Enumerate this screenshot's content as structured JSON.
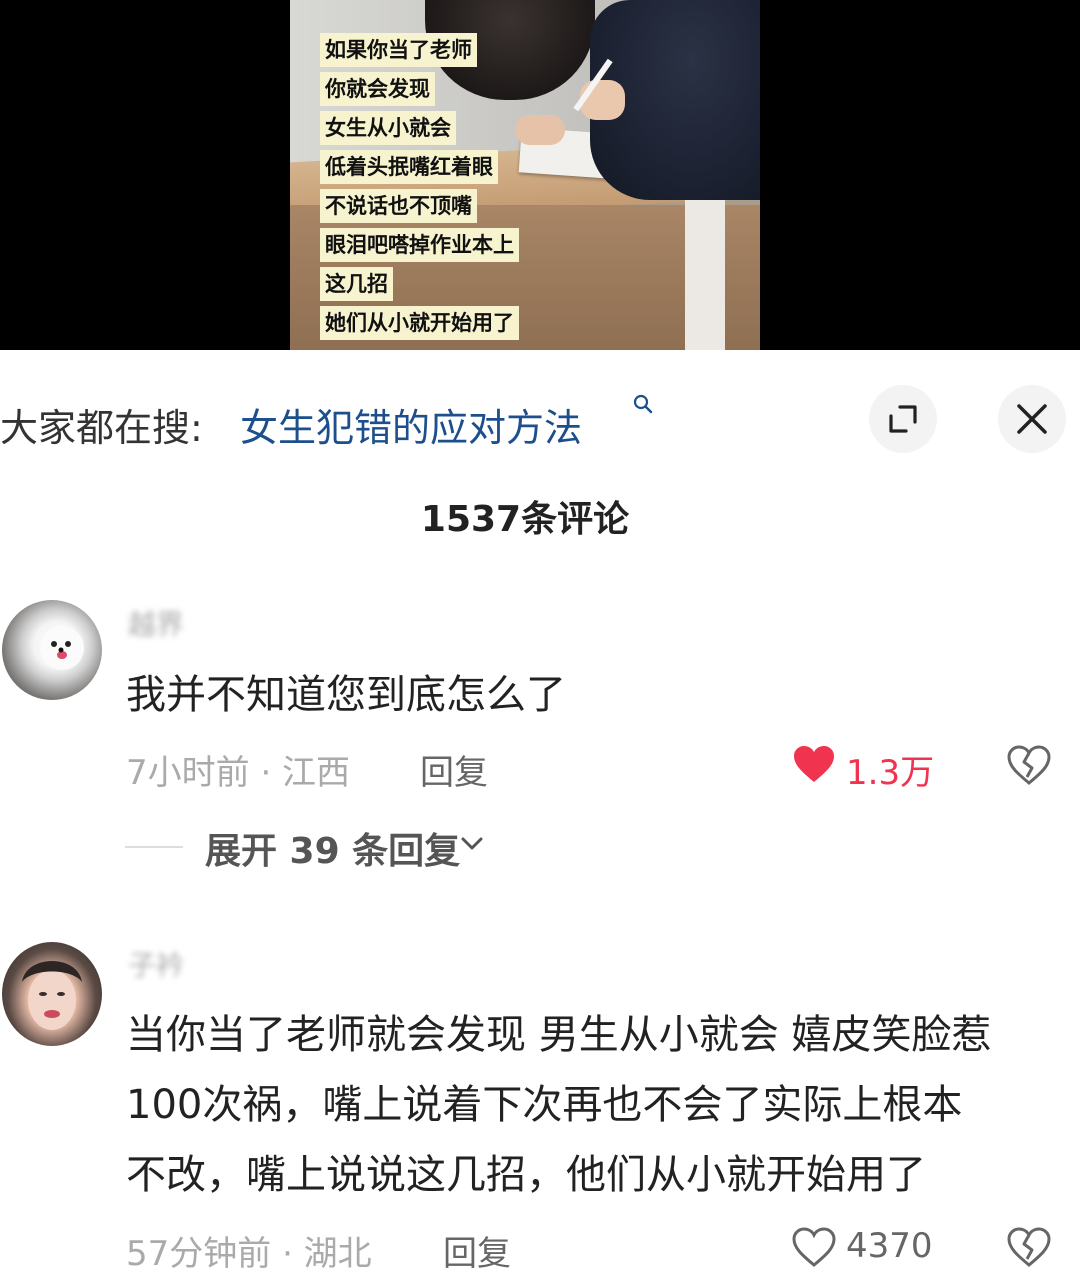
{
  "video": {
    "captions": [
      "如果你当了老师",
      "你就会发现",
      "女生从小就会",
      "低着头抿嘴红着眼",
      "不说话也不顶嘴",
      "眼泪吧嗒掉作业本上",
      "这几招",
      "她们从小就开始用了"
    ]
  },
  "search": {
    "prefix": "大家都在搜:",
    "query": "女生犯错的应对方法"
  },
  "comments_header": {
    "count_label": "1537条评论"
  },
  "comments": [
    {
      "username": "越界",
      "text": "我并不知道您到底怎么了",
      "time_location": "7小时前 · 江西",
      "reply_label": "回复",
      "likes": "1.3万",
      "liked": true,
      "expand_label": "展开 39 条回复"
    },
    {
      "username": "子衿",
      "text_lines": [
        "当你当了老师就会发现 男生从小就会 嬉皮笑脸惹",
        "100次祸，嘴上说着下次再也不会了实际上根本",
        "不改，嘴上说说这几招，他们从小就开始用了"
      ],
      "time_location": "57分钟前 · 湖北",
      "reply_label": "回复",
      "likes": "4370",
      "liked": false
    }
  ],
  "colors": {
    "like_red": "#f0334f",
    "link_blue": "#1c4f8c",
    "caption_bg": "#f6f3ce"
  }
}
